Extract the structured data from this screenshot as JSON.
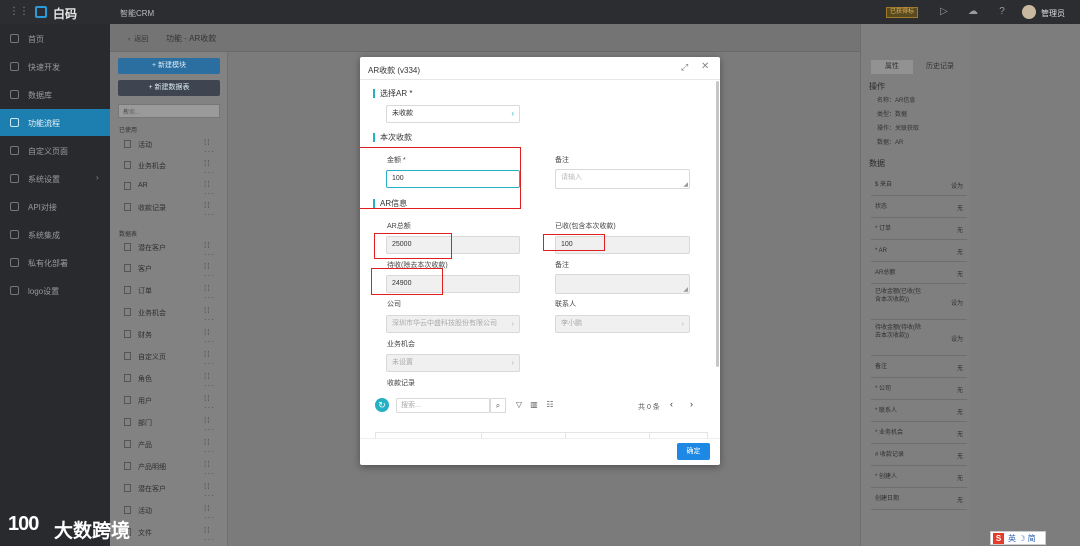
{
  "topbar": {
    "logo": "白码",
    "app_name": "智能CRM",
    "tag": "已获得标",
    "user": "管理员"
  },
  "sidebar": {
    "items": [
      {
        "label": "首页"
      },
      {
        "label": "快速开发"
      },
      {
        "label": "数据库"
      },
      {
        "label": "功能流程"
      },
      {
        "label": "自定义页面"
      },
      {
        "label": "系统设置"
      },
      {
        "label": "API对接"
      },
      {
        "label": "系统集成"
      },
      {
        "label": "私有化部署"
      },
      {
        "label": "logo设置"
      }
    ]
  },
  "breadcrumb": {
    "back": "返回",
    "path": "功能 - AR收款"
  },
  "func_panel": {
    "new_module": "+ 新建模块",
    "new_table": "+ 新建数据表",
    "search_placeholder": "搜索...",
    "section_used": "已使用",
    "used_items": [
      {
        "label": "活动"
      },
      {
        "label": "业务机会"
      },
      {
        "label": "AR"
      },
      {
        "label": "收款记录"
      }
    ],
    "section_tables": "数据表",
    "table_items": [
      {
        "label": "潜在客户"
      },
      {
        "label": "客户"
      },
      {
        "label": "订单"
      },
      {
        "label": "业务机会"
      },
      {
        "label": "财务"
      },
      {
        "label": "自定义页"
      },
      {
        "label": "角色"
      },
      {
        "label": "用户"
      },
      {
        "label": "部门"
      },
      {
        "label": "产品"
      },
      {
        "label": "产品明细"
      },
      {
        "label": "潜在客户"
      },
      {
        "label": "活动"
      },
      {
        "label": "文件"
      }
    ]
  },
  "right_panel": {
    "tabs": [
      {
        "label": "属性"
      },
      {
        "label": "历史记录"
      }
    ],
    "ops_title": "操作",
    "ops": [
      {
        "text": "名称：AR信息"
      },
      {
        "text": "类型：数据"
      },
      {
        "text": "操作：关联获取"
      },
      {
        "text": "数据：AR"
      }
    ],
    "data_title": "数据",
    "rows": [
      {
        "k": "$ 来自",
        "v": "设为"
      },
      {
        "k": "状态",
        "v": "无"
      },
      {
        "k": "* 订单",
        "v": "无"
      },
      {
        "k": "* AR",
        "v": "无"
      },
      {
        "k": "AR总额",
        "v": "无"
      },
      {
        "k": "已收金额(已收(包含本次收款))",
        "v": "设为"
      },
      {
        "k": "待收金额(待收(除去本次收款))",
        "v": "设为"
      },
      {
        "k": "备注",
        "v": "无"
      },
      {
        "k": "* 公司",
        "v": "无"
      },
      {
        "k": "* 联系人",
        "v": "无"
      },
      {
        "k": "* 业务机会",
        "v": "无"
      },
      {
        "k": "# 收款记录",
        "v": "无"
      },
      {
        "k": "* 创建人",
        "v": "无"
      },
      {
        "k": "创建日期",
        "v": "无"
      }
    ]
  },
  "modal": {
    "title": "AR收款 (v334)",
    "select_ar_label": "选择AR *",
    "select_ar_value": "未收款",
    "section_receipt": "本次收款",
    "amount_label": "金额 *",
    "amount_value": "100",
    "note_label": "备注",
    "note_placeholder": "请输入",
    "section_ar_info": "AR信息",
    "ar_total_label": "AR总额",
    "ar_total_value": "25000",
    "received_label": "已收(包含本次收款)",
    "received_value": "100",
    "pending_label": "待收(除去本次收款)",
    "pending_value": "24900",
    "note2_label": "备注",
    "company_label": "公司",
    "company_value": "深圳市华云中盛科技股份有限公司",
    "contact_label": "联系人",
    "contact_value": "李小鹏",
    "opportunity_label": "业务机会",
    "opportunity_value": "未设置",
    "records_label": "收款记录",
    "search_placeholder": "搜索...",
    "pager_text": "共 0 条",
    "ok_label": "确定"
  },
  "watermark": {
    "logo": "100",
    "text": "大数跨境"
  },
  "ime": {
    "text": "英 ☽ 简"
  }
}
